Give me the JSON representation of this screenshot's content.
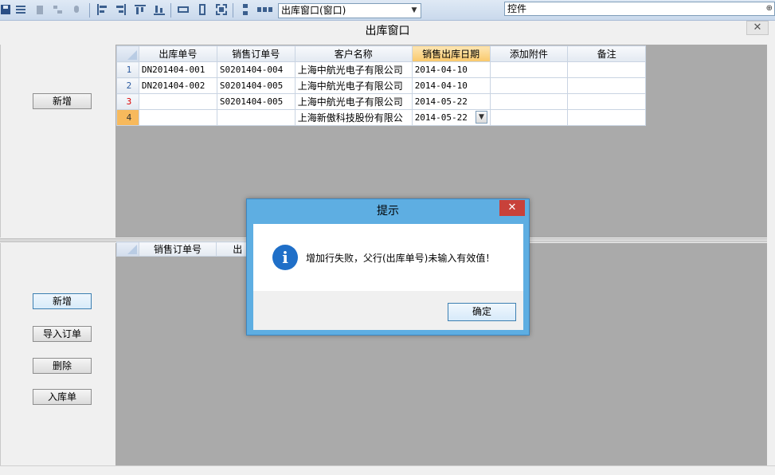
{
  "toolbar": {
    "window_select_value": "出库窗口(窗口)",
    "control_panel_title": "控件",
    "icons": [
      "save-icon",
      "list-icon",
      "delete-icon",
      "tree-icon",
      "help-icon",
      "align-left-icon",
      "align-right-icon",
      "align-top-icon",
      "align-bottom-icon",
      "same-width-icon",
      "same-height-icon",
      "same-size-icon",
      "vertical-space-icon",
      "horizontal-space-icon"
    ]
  },
  "window": {
    "title": "出库窗口",
    "close_glyph": "✕"
  },
  "top_panel": {
    "add_label": "新增",
    "grid": {
      "headers": [
        "出库单号",
        "销售订单号",
        "客户名称",
        "销售出库日期",
        "添加附件",
        "备注"
      ],
      "rows": [
        {
          "n": "1",
          "cells": [
            "DN201404-001",
            "S0201404-004",
            "上海中航光电子有限公司",
            "2014-04-10",
            "",
            ""
          ]
        },
        {
          "n": "2",
          "cells": [
            "DN201404-002",
            "S0201404-005",
            "上海中航光电子有限公司",
            "2014-04-10",
            "",
            ""
          ]
        },
        {
          "n": "3",
          "cells": [
            "",
            "S0201404-005",
            "上海中航光电子有限公司",
            "2014-05-22",
            "",
            ""
          ]
        },
        {
          "n": "4",
          "cells": [
            "",
            "",
            "上海新傲科技股份有限公",
            "2014-05-22",
            "",
            ""
          ]
        }
      ]
    }
  },
  "bottom_panel": {
    "buttons": {
      "add": "新增",
      "import": "导入订单",
      "delete": "删除",
      "stock_in": "入库单"
    },
    "grid": {
      "headers": [
        "销售订单号",
        "出"
      ]
    }
  },
  "dialog": {
    "title": "提示",
    "message": "增加行失败，父行(出库单号)未输入有效值！",
    "ok_label": "确定",
    "close_glyph": "✕"
  }
}
